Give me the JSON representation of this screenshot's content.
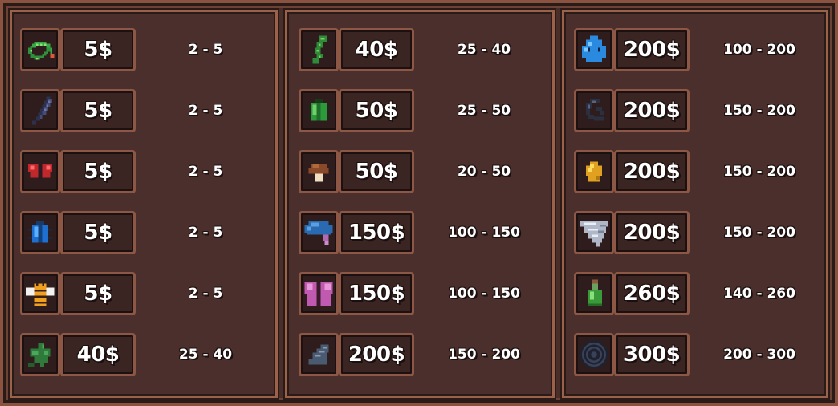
{
  "columns": [
    {
      "items": [
        {
          "icon": "worm-icon",
          "price": "5$",
          "range": "2 - 5"
        },
        {
          "icon": "feather-icon",
          "price": "5$",
          "range": "2 - 5"
        },
        {
          "icon": "red-butterfly-icon",
          "price": "5$",
          "range": "2 - 5"
        },
        {
          "icon": "blue-beetle-icon",
          "price": "5$",
          "range": "2 - 5"
        },
        {
          "icon": "bee-icon",
          "price": "5$",
          "range": "2 - 5"
        },
        {
          "icon": "green-leaf-icon",
          "price": "40$",
          "range": "25 - 40"
        }
      ]
    },
    {
      "items": [
        {
          "icon": "green-caterpillar-icon",
          "price": "40$",
          "range": "25 - 40"
        },
        {
          "icon": "green-beetle-icon",
          "price": "50$",
          "range": "25 - 50"
        },
        {
          "icon": "brown-mushroom-icon",
          "price": "50$",
          "range": "20 - 50"
        },
        {
          "icon": "blue-mushroom-icon",
          "price": "150$",
          "range": "100 - 150"
        },
        {
          "icon": "pink-butterfly-icon",
          "price": "150$",
          "range": "100 - 150"
        },
        {
          "icon": "fin-icon",
          "price": "200$",
          "range": "150 - 200"
        }
      ]
    },
    {
      "items": [
        {
          "icon": "blue-slime-icon",
          "price": "200$",
          "range": "100 - 200"
        },
        {
          "icon": "dark-claw-icon",
          "price": "200$",
          "range": "150 - 200"
        },
        {
          "icon": "gold-nugget-icon",
          "price": "200$",
          "range": "150 - 200"
        },
        {
          "icon": "tornado-icon",
          "price": "200$",
          "range": "150 - 200"
        },
        {
          "icon": "green-potion-icon",
          "price": "260$",
          "range": "140 - 260"
        },
        {
          "icon": "dark-spiral-icon",
          "price": "300$",
          "range": "200 - 300"
        }
      ]
    }
  ],
  "colors": {
    "background": "#4a2f2c",
    "border": "#9b6149",
    "text": "#ffffff"
  }
}
